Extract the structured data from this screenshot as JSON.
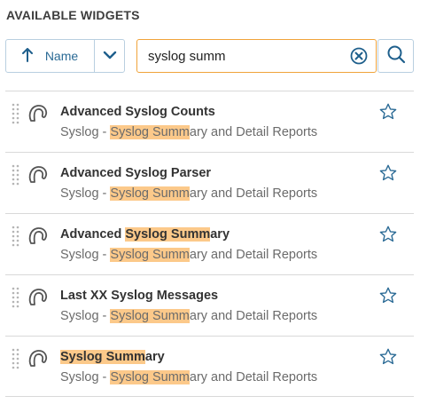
{
  "panel": {
    "title": "AVAILABLE WIDGETS"
  },
  "sort": {
    "label": "Name",
    "arrow_icon": "arrow-up-icon",
    "dropdown_icon": "chevron-down-icon"
  },
  "search": {
    "value": "syslog summ",
    "clear_icon": "clear-circle-icon",
    "search_icon": "magnifier-icon"
  },
  "colors": {
    "accent": "#1e5f8c",
    "search_border": "#f0a33a",
    "highlight": "#fcc98a"
  },
  "widgets": [
    {
      "name": {
        "pre": "Advanced Syslog Counts",
        "hl": "",
        "post": ""
      },
      "desc": {
        "pre": "Syslog - ",
        "hl": "Syslog Summ",
        "post": "ary and Detail Reports"
      }
    },
    {
      "name": {
        "pre": "Advanced Syslog Parser",
        "hl": "",
        "post": ""
      },
      "desc": {
        "pre": "Syslog - ",
        "hl": "Syslog Summ",
        "post": "ary and Detail Reports"
      }
    },
    {
      "name": {
        "pre": "Advanced ",
        "hl": "Syslog Summ",
        "post": "ary"
      },
      "desc": {
        "pre": "Syslog - ",
        "hl": "Syslog Summ",
        "post": "ary and Detail Reports"
      }
    },
    {
      "name": {
        "pre": "Last XX Syslog Messages",
        "hl": "",
        "post": ""
      },
      "desc": {
        "pre": "Syslog - ",
        "hl": "Syslog Summ",
        "post": "ary and Detail Reports"
      }
    },
    {
      "name": {
        "pre": "",
        "hl": "Syslog Summ",
        "post": "ary"
      },
      "desc": {
        "pre": "Syslog - ",
        "hl": "Syslog Summ",
        "post": "ary and Detail Reports"
      }
    }
  ]
}
